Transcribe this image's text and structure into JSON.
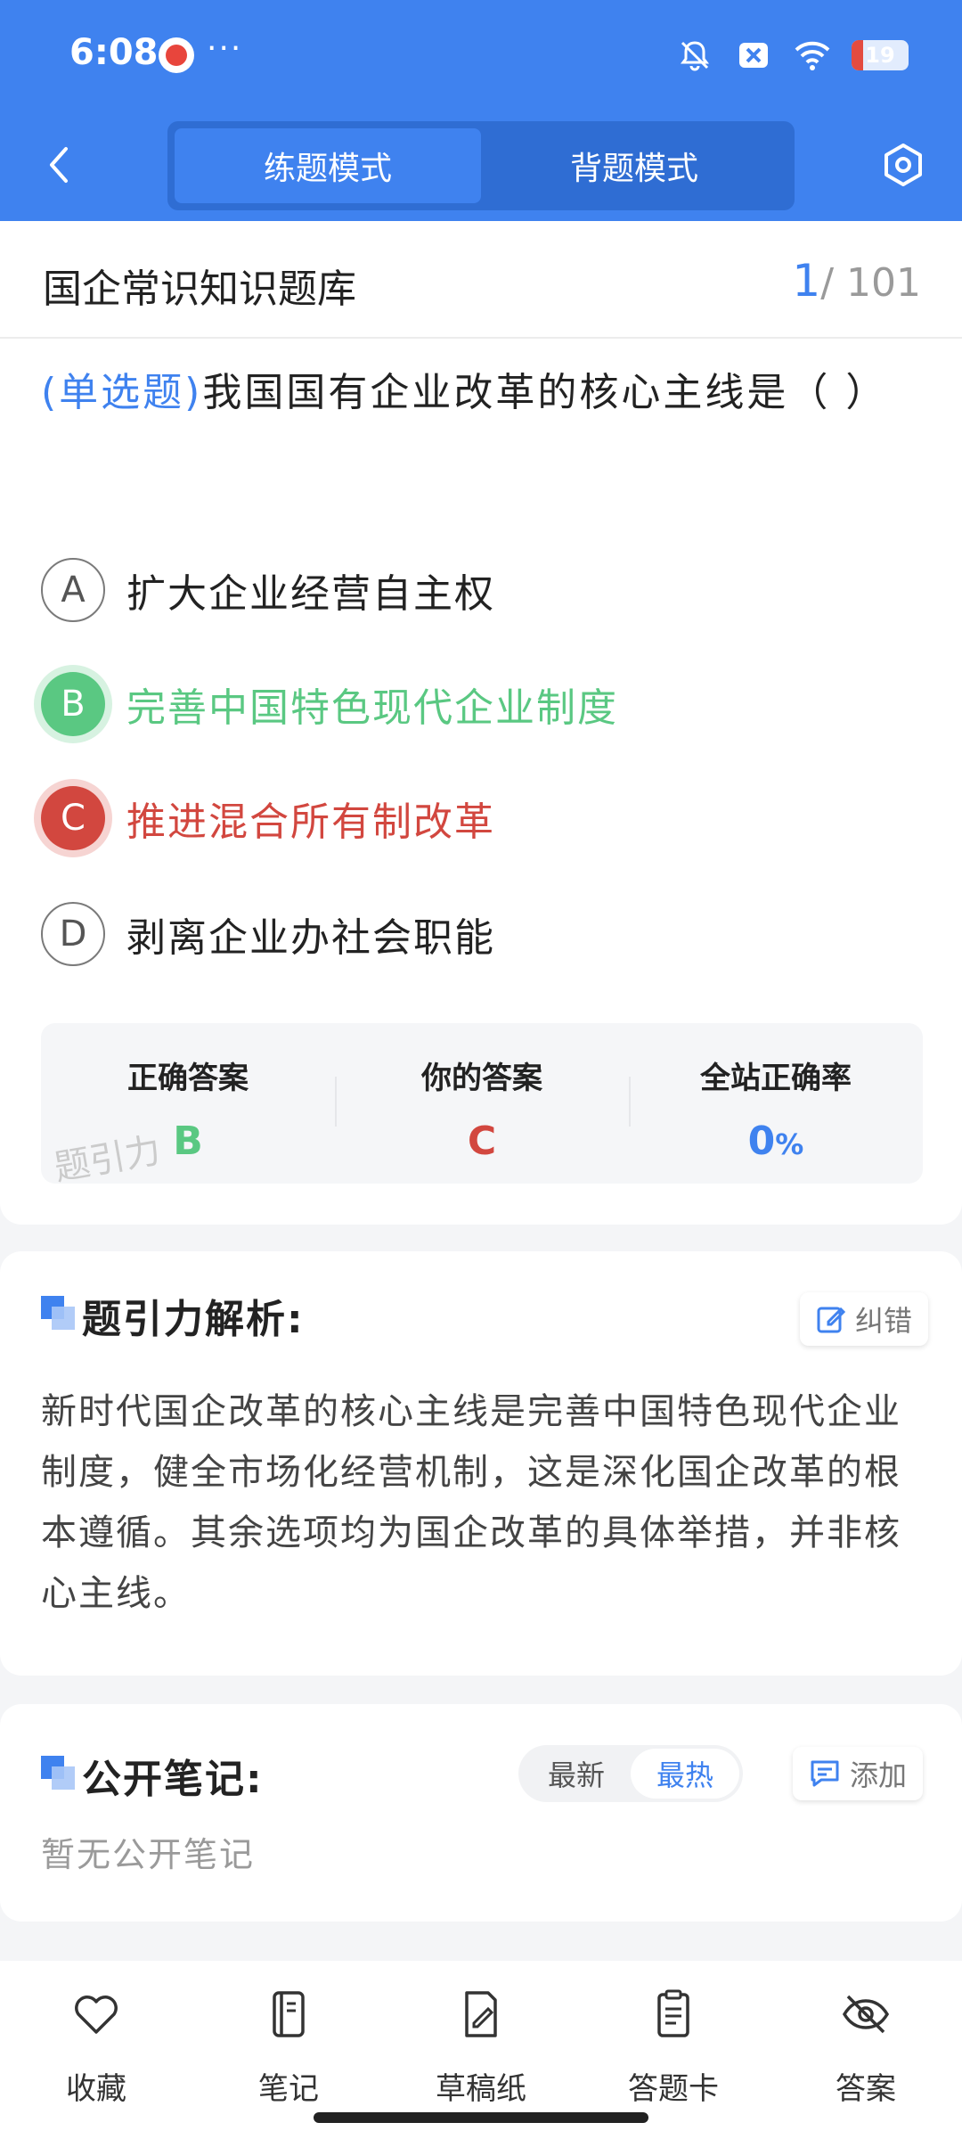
{
  "status_bar": {
    "time": "6:08",
    "dots": "···",
    "battery": "19",
    "icons": [
      "app-icon",
      "bell-muted-icon",
      "close-box-icon",
      "wifi-icon",
      "battery-icon"
    ]
  },
  "header": {
    "tabs": [
      {
        "label": "练题模式",
        "active": true
      },
      {
        "label": "背题模式",
        "active": false
      }
    ],
    "back_icon": "chevron-left-icon",
    "settings_icon": "hexagon-settings-icon"
  },
  "question": {
    "bank_title": "国企常识知识题库",
    "progress_current": "1",
    "progress_total": "/ 101",
    "type": "(单选题)",
    "text": "我国国有企业改革的核心主线是（ ）",
    "options": [
      {
        "letter": "A",
        "text": "扩大企业经营自主权",
        "state": "normal"
      },
      {
        "letter": "B",
        "text": "完善中国特色现代企业制度",
        "state": "correct"
      },
      {
        "letter": "C",
        "text": "推进混合所有制改革",
        "state": "wrong"
      },
      {
        "letter": "D",
        "text": "剥离企业办社会职能",
        "state": "normal"
      }
    ]
  },
  "summary": {
    "correct_label": "正确答案",
    "correct_value": "B",
    "yours_label": "你的答案",
    "yours_value": "C",
    "rate_label": "全站正确率",
    "rate_value": "0",
    "rate_unit": "%",
    "watermark": "题引力"
  },
  "analysis": {
    "title": "题引力解析:",
    "correct_button": "纠错",
    "body": "新时代国企改革的核心主线是完善中国特色现代企业制度，健全市场化经营机制，这是深化国企改革的根本遵循。其余选项均为国企改革的具体举措，并非核心主线。"
  },
  "notes": {
    "title": "公开笔记:",
    "sort_tabs": [
      {
        "label": "最新",
        "active": false
      },
      {
        "label": "最热",
        "active": true
      }
    ],
    "add_button": "添加",
    "empty_text": "暂无公开笔记"
  },
  "bottom_nav": [
    {
      "label": "收藏",
      "icon": "heart-icon"
    },
    {
      "label": "笔记",
      "icon": "notebook-icon"
    },
    {
      "label": "草稿纸",
      "icon": "draft-paper-icon"
    },
    {
      "label": "答题卡",
      "icon": "answer-card-icon"
    },
    {
      "label": "答案",
      "icon": "eye-hidden-icon"
    }
  ],
  "colors": {
    "primary": "#3f82ef",
    "correct": "#5ac882",
    "wrong": "#d2473f"
  }
}
